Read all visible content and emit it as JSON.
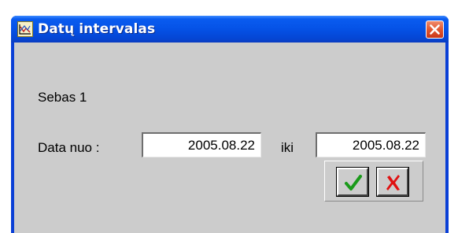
{
  "window": {
    "title": "Datų intervalas"
  },
  "dialog": {
    "group_label": "Sebas 1",
    "date_from_label": "Data nuo :",
    "date_from_value": "2005.08.22",
    "date_to_label": "iki",
    "date_to_value": "2005.08.22"
  },
  "icons": {
    "app": "chart-icon",
    "close": "close-icon",
    "ok": "checkmark-icon",
    "cancel": "red-x-icon"
  },
  "colors": {
    "titlebar": "#0552e6",
    "client_bg": "#cccccc",
    "ok_check": "#1a9a1a",
    "cancel_x": "#e01010",
    "close_button": "#e1572f"
  }
}
